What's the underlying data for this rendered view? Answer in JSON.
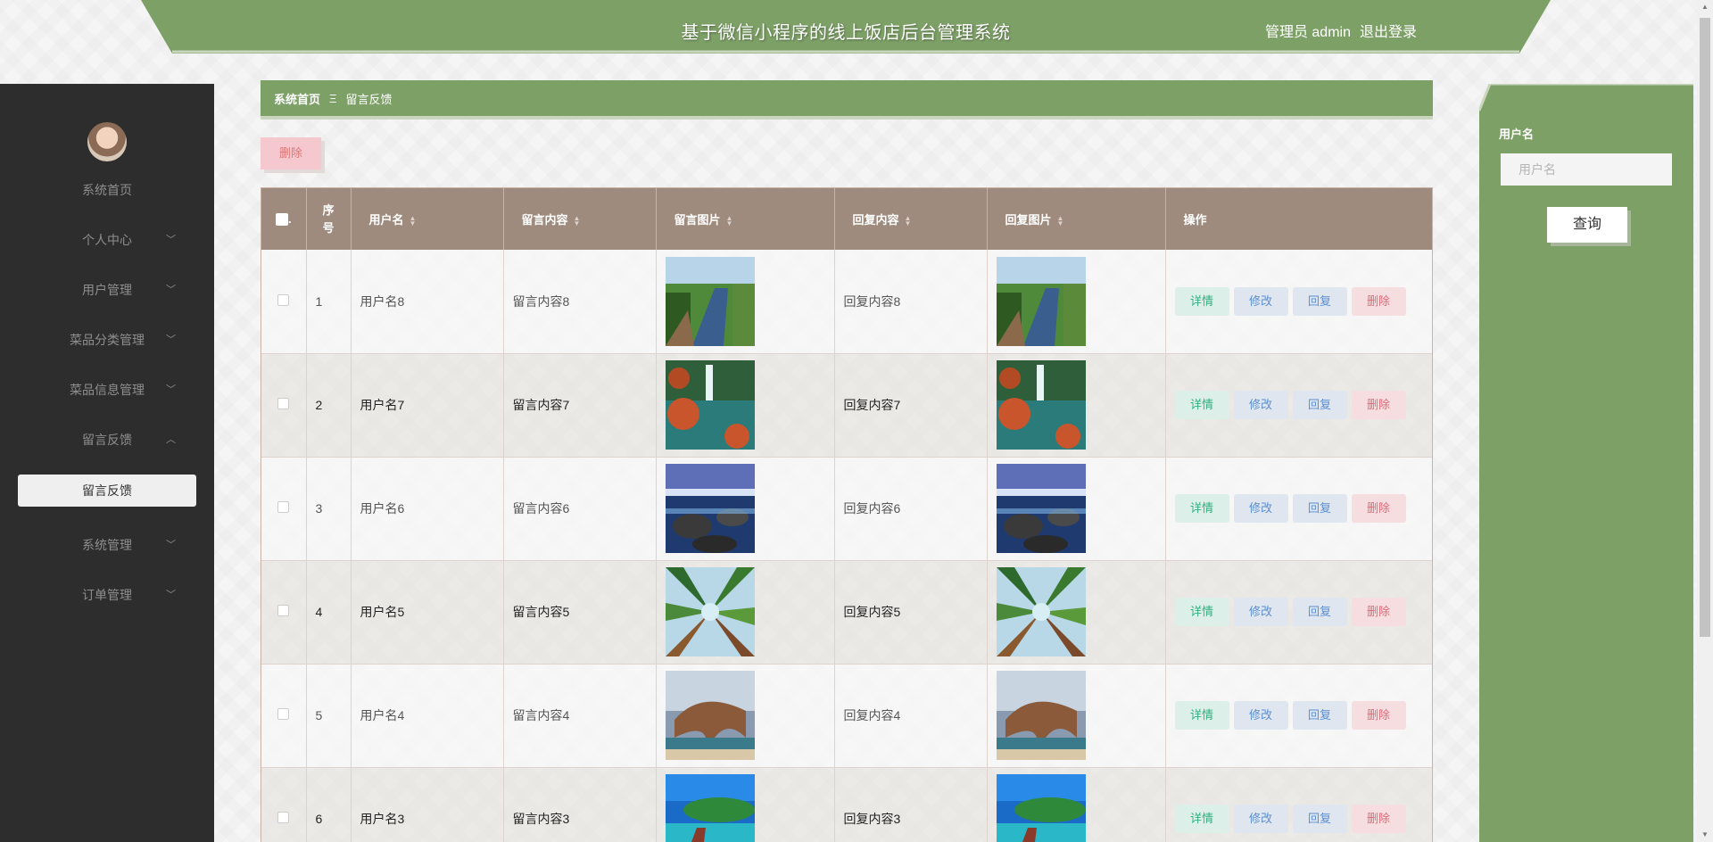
{
  "header": {
    "title": "基于微信小程序的线上饭店后台管理系统",
    "user": "管理员 admin",
    "logout": "退出登录"
  },
  "sidebar": {
    "items": [
      {
        "label": "系统首页",
        "chevron": ""
      },
      {
        "label": "个人中心",
        "chevron": "﹀"
      },
      {
        "label": "用户管理",
        "chevron": "﹀"
      },
      {
        "label": "菜品分类管理",
        "chevron": "﹀"
      },
      {
        "label": "菜品信息管理",
        "chevron": "﹀"
      },
      {
        "label": "留言反馈",
        "chevron": "︿"
      },
      {
        "label": "系统管理",
        "chevron": "﹀"
      },
      {
        "label": "订单管理",
        "chevron": "﹀"
      }
    ],
    "active_sub": "留言反馈"
  },
  "breadcrumb": {
    "home": "系统首页",
    "sep": "Ξ",
    "current": "留言反馈"
  },
  "toolbar": {
    "delete_label": "删除"
  },
  "table": {
    "headers": {
      "no": "序号",
      "username": "用户名",
      "content": "留言内容",
      "image": "留言图片",
      "reply": "回复内容",
      "reply_image": "回复图片",
      "ops": "操作"
    },
    "rows": [
      {
        "no": "1",
        "username": "用户名8",
        "content": "留言内容8",
        "reply": "回复内容8",
        "img": "river"
      },
      {
        "no": "2",
        "username": "用户名7",
        "content": "留言内容7",
        "reply": "回复内容7",
        "img": "lake"
      },
      {
        "no": "3",
        "username": "用户名6",
        "content": "留言内容6",
        "reply": "回复内容6",
        "img": "rocks"
      },
      {
        "no": "4",
        "username": "用户名5",
        "content": "留言内容5",
        "reply": "回复内容5",
        "img": "forest"
      },
      {
        "no": "5",
        "username": "用户名4",
        "content": "留言内容4",
        "reply": "回复内容4",
        "img": "arch"
      },
      {
        "no": "6",
        "username": "用户名3",
        "content": "留言内容3",
        "reply": "回复内容3",
        "img": "pier"
      }
    ],
    "ops": {
      "detail": "详情",
      "edit": "修改",
      "reply": "回复",
      "delete": "删除"
    }
  },
  "search": {
    "label": "用户名",
    "placeholder": "用户名",
    "button": "查询"
  },
  "colors": {
    "primary_green": "#7da067",
    "table_header": "#9e8b7e",
    "sidebar_bg": "#2d2d2d"
  }
}
